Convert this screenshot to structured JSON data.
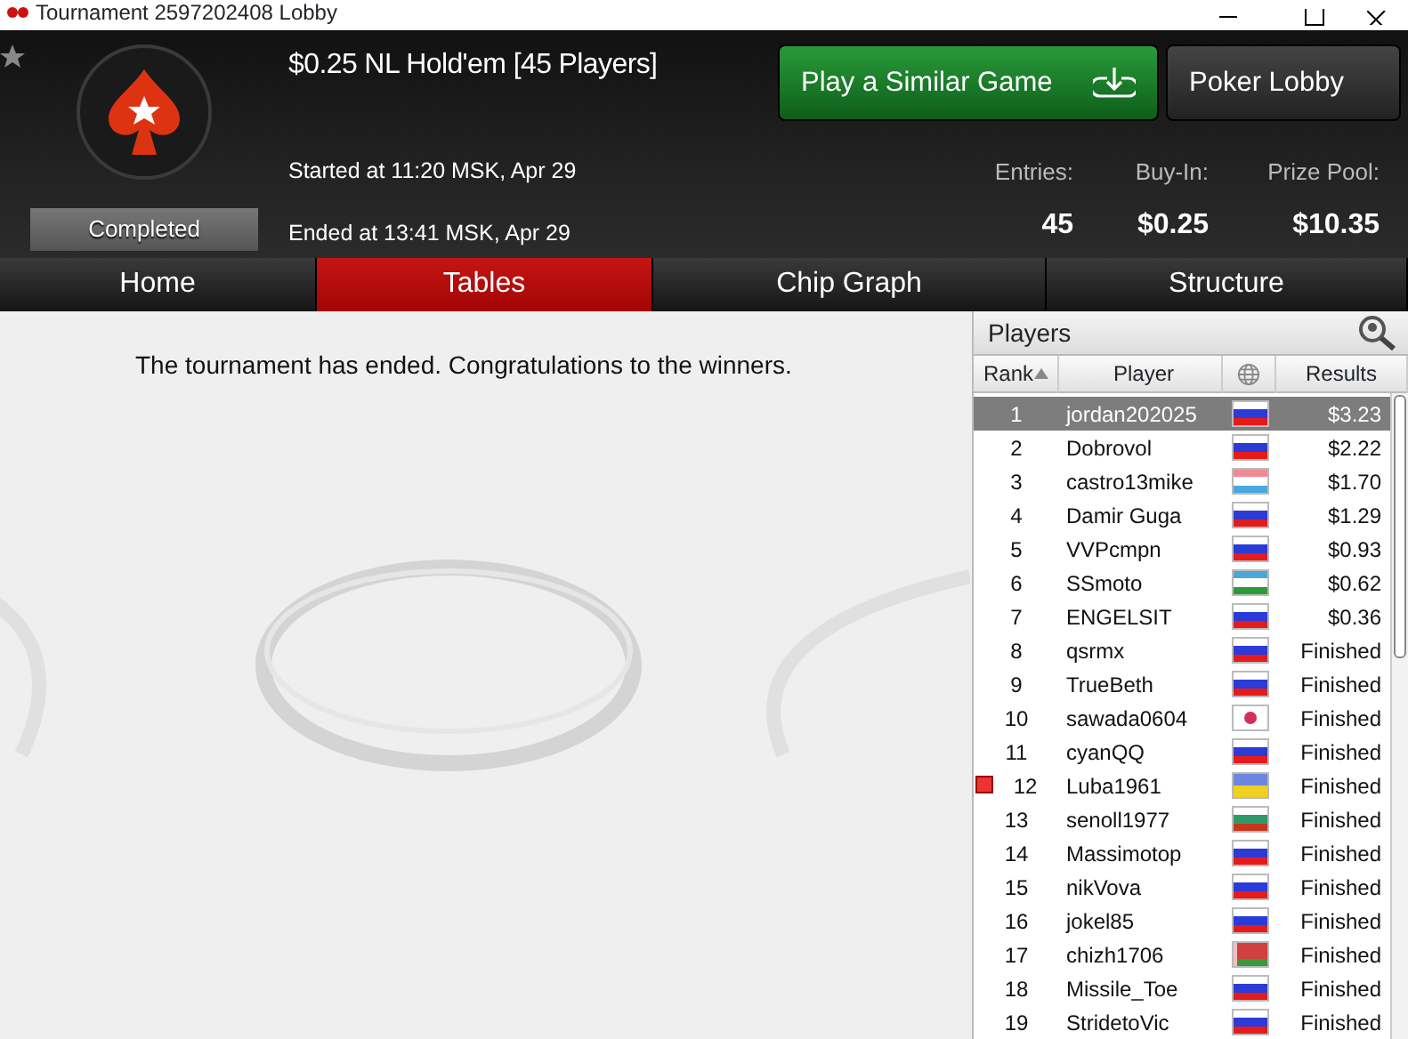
{
  "window": {
    "title": "Tournament 2597202408 Lobby"
  },
  "header": {
    "title": "$0.25 NL Hold'em [45 Players]",
    "status": "Completed",
    "started": "Started at 11:20 MSK, Apr 29",
    "ended": "Ended at 13:41 MSK, Apr 29",
    "buttons": [
      {
        "label": "Play a Similar Game",
        "kind": "primary"
      },
      {
        "label": "Poker Lobby",
        "kind": "secondary"
      }
    ],
    "stats": [
      {
        "label": "Entries:",
        "value": "45"
      },
      {
        "label": "Buy-In:",
        "value": "$0.25"
      },
      {
        "label": "Prize Pool:",
        "value": "$10.35"
      }
    ]
  },
  "tabs": [
    {
      "label": "Home",
      "selected": false
    },
    {
      "label": "Tables",
      "selected": true
    },
    {
      "label": "Chip Graph",
      "selected": false
    },
    {
      "label": "Structure",
      "selected": false
    }
  ],
  "message": "The tournament has ended. Congratulations to the winners.",
  "players": {
    "title": "Players",
    "columns": [
      "Rank",
      "Player",
      "Results"
    ],
    "rows": [
      {
        "rank": "1",
        "player": "jordan202025",
        "kind": "ru",
        "result": "$3.23",
        "selected": true,
        "marked": false
      },
      {
        "rank": "2",
        "player": "Dobrovol",
        "kind": "ru",
        "result": "$2.22",
        "selected": false,
        "marked": false
      },
      {
        "rank": "3",
        "player": "castro13mike",
        "kind": "lu",
        "result": "$1.70",
        "selected": false,
        "marked": false
      },
      {
        "rank": "4",
        "player": "Damir Guga",
        "kind": "ru",
        "result": "$1.29",
        "selected": false,
        "marked": false
      },
      {
        "rank": "5",
        "player": "VVPcmpn",
        "kind": "ru",
        "result": "$0.93",
        "selected": false,
        "marked": false
      },
      {
        "rank": "6",
        "player": "SSmoto",
        "kind": "uz",
        "result": "$0.62",
        "selected": false,
        "marked": false
      },
      {
        "rank": "7",
        "player": "ENGELSIT",
        "kind": "ru",
        "result": "$0.36",
        "selected": false,
        "marked": false
      },
      {
        "rank": "8",
        "player": "qsrmx",
        "kind": "ru",
        "result": "Finished",
        "selected": false,
        "marked": false
      },
      {
        "rank": "9",
        "player": "TrueBeth",
        "kind": "ru",
        "result": "Finished",
        "selected": false,
        "marked": false
      },
      {
        "rank": "10",
        "player": "sawada0604",
        "kind": "jp",
        "result": "Finished",
        "selected": false,
        "marked": false
      },
      {
        "rank": "11",
        "player": "cyanQQ",
        "kind": "ru",
        "result": "Finished",
        "selected": false,
        "marked": false
      },
      {
        "rank": "12",
        "player": "Luba1961",
        "kind": "ua",
        "result": "Finished",
        "selected": false,
        "marked": true
      },
      {
        "rank": "13",
        "player": "senoll1977",
        "kind": "bg",
        "result": "Finished",
        "selected": false,
        "marked": false
      },
      {
        "rank": "14",
        "player": "Massimotop",
        "kind": "ru",
        "result": "Finished",
        "selected": false,
        "marked": false
      },
      {
        "rank": "15",
        "player": "nikVova",
        "kind": "ru",
        "result": "Finished",
        "selected": false,
        "marked": false
      },
      {
        "rank": "16",
        "player": "jokel85",
        "kind": "ru",
        "result": "Finished",
        "selected": false,
        "marked": false
      },
      {
        "rank": "17",
        "player": "chizh1706",
        "kind": "by",
        "result": "Finished",
        "selected": false,
        "marked": false
      },
      {
        "rank": "18",
        "player": "Missile_Toe",
        "kind": "ru",
        "result": "Finished",
        "selected": false,
        "marked": false
      },
      {
        "rank": "19",
        "player": "StridetoVic",
        "kind": "ru",
        "result": "Finished",
        "selected": false,
        "marked": false
      }
    ]
  }
}
